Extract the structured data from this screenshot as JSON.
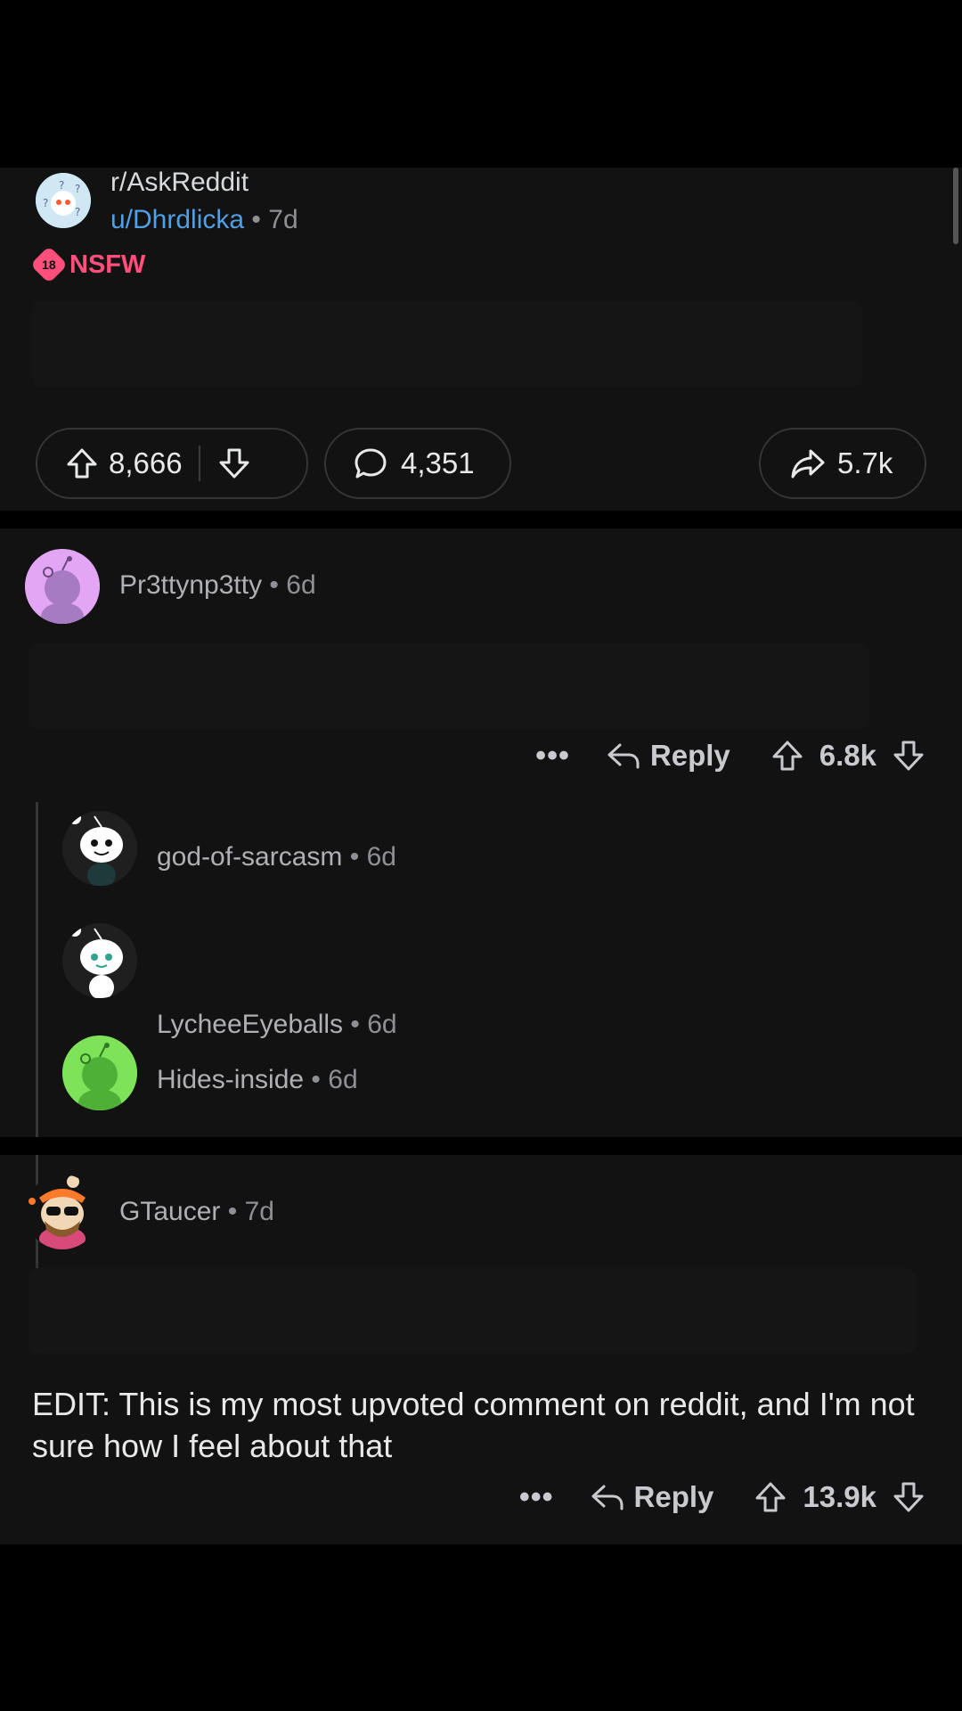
{
  "post": {
    "subreddit": "r/AskReddit",
    "user": "u/Dhrdlicka",
    "separator": "•",
    "age": "7d",
    "nsfw_label": "NSFW",
    "nsfw_badge": "18",
    "upvotes": "8,666",
    "comments": "4,351",
    "shares": "5.7k"
  },
  "comments": [
    {
      "author": "Pr3ttynp3tty",
      "age": "6d",
      "score": "6.8k",
      "reply_label": "Reply",
      "more": "•••",
      "avatar_color": "#e2a6f5",
      "replies": [
        {
          "author": "god-of-sarcasm",
          "age": "6d"
        },
        {
          "author": "LycheeEyeballs",
          "age": "6d"
        },
        {
          "author": "Hides-inside",
          "age": "6d",
          "avatar_color": "#7fe35a"
        }
      ]
    },
    {
      "author": "GTaucer",
      "age": "7d",
      "text": "EDIT: This is my most upvoted comment on reddit, and I'm not sure how I feel about that",
      "score": "13.9k",
      "reply_label": "Reply",
      "more": "•••"
    }
  ],
  "colors": {
    "background": "#121212",
    "user_link": "#4fa0e6",
    "nsfw": "#ff4f7a"
  }
}
